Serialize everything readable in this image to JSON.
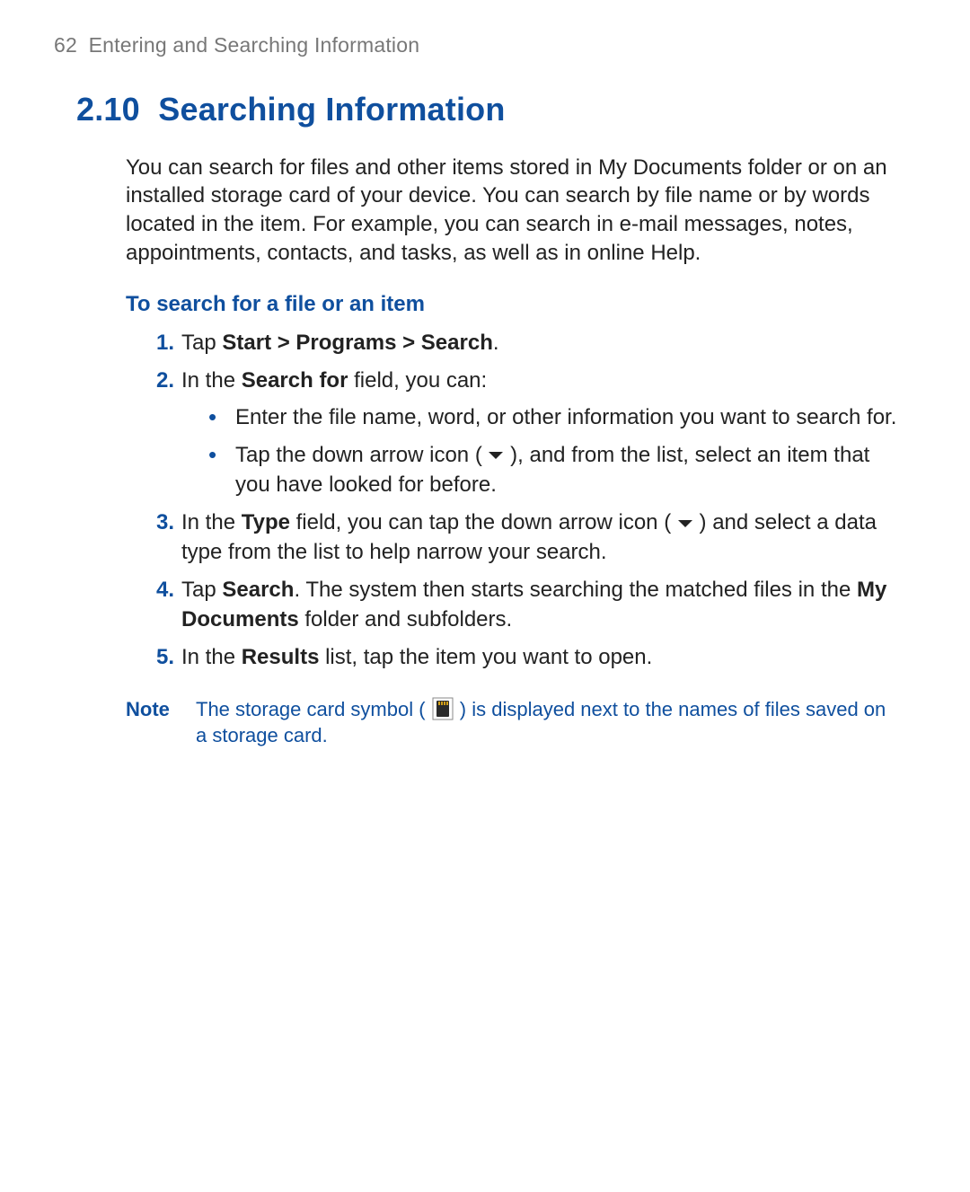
{
  "header": {
    "page_number": "62",
    "chapter": "Entering and Searching Information"
  },
  "section": {
    "number": "2.10",
    "title": "Searching Information"
  },
  "intro": "You can search for files and other items stored in My Documents folder or on an installed storage card of your device. You can search by file name or by words located in the item. For example, you can search in e-mail messages, notes, appointments, contacts, and tasks, as well as in online Help.",
  "subhead": "To search for a file or an item",
  "steps": {
    "s1": {
      "num": "1.",
      "pre": "Tap ",
      "bold": "Start > Programs > Search",
      "post": "."
    },
    "s2": {
      "num": "2.",
      "pre": "In the ",
      "bold": "Search for",
      "post": " field, you can:",
      "bullets": {
        "b1": "Enter the file name, word, or other information you want to search for.",
        "b2a": "Tap the down arrow icon (",
        "b2b": "), and from the list, select an item that you have looked for before."
      }
    },
    "s3": {
      "num": "3.",
      "pre": "In the ",
      "bold": "Type",
      "mid": " field, you can tap the down arrow icon (",
      "post": ") and select a data type from the list to help narrow your search."
    },
    "s4": {
      "num": "4.",
      "pre": "Tap ",
      "bold1": "Search",
      "mid": ". The system then starts searching the matched files in the ",
      "bold2": "My Documents",
      "post": " folder and subfolders."
    },
    "s5": {
      "num": "5.",
      "pre": "In the ",
      "bold": "Results",
      "post": " list, tap the item you want to open."
    }
  },
  "note": {
    "label": "Note",
    "pre": "The storage card symbol (",
    "post": ") is displayed next to the names of files saved on a storage card."
  }
}
